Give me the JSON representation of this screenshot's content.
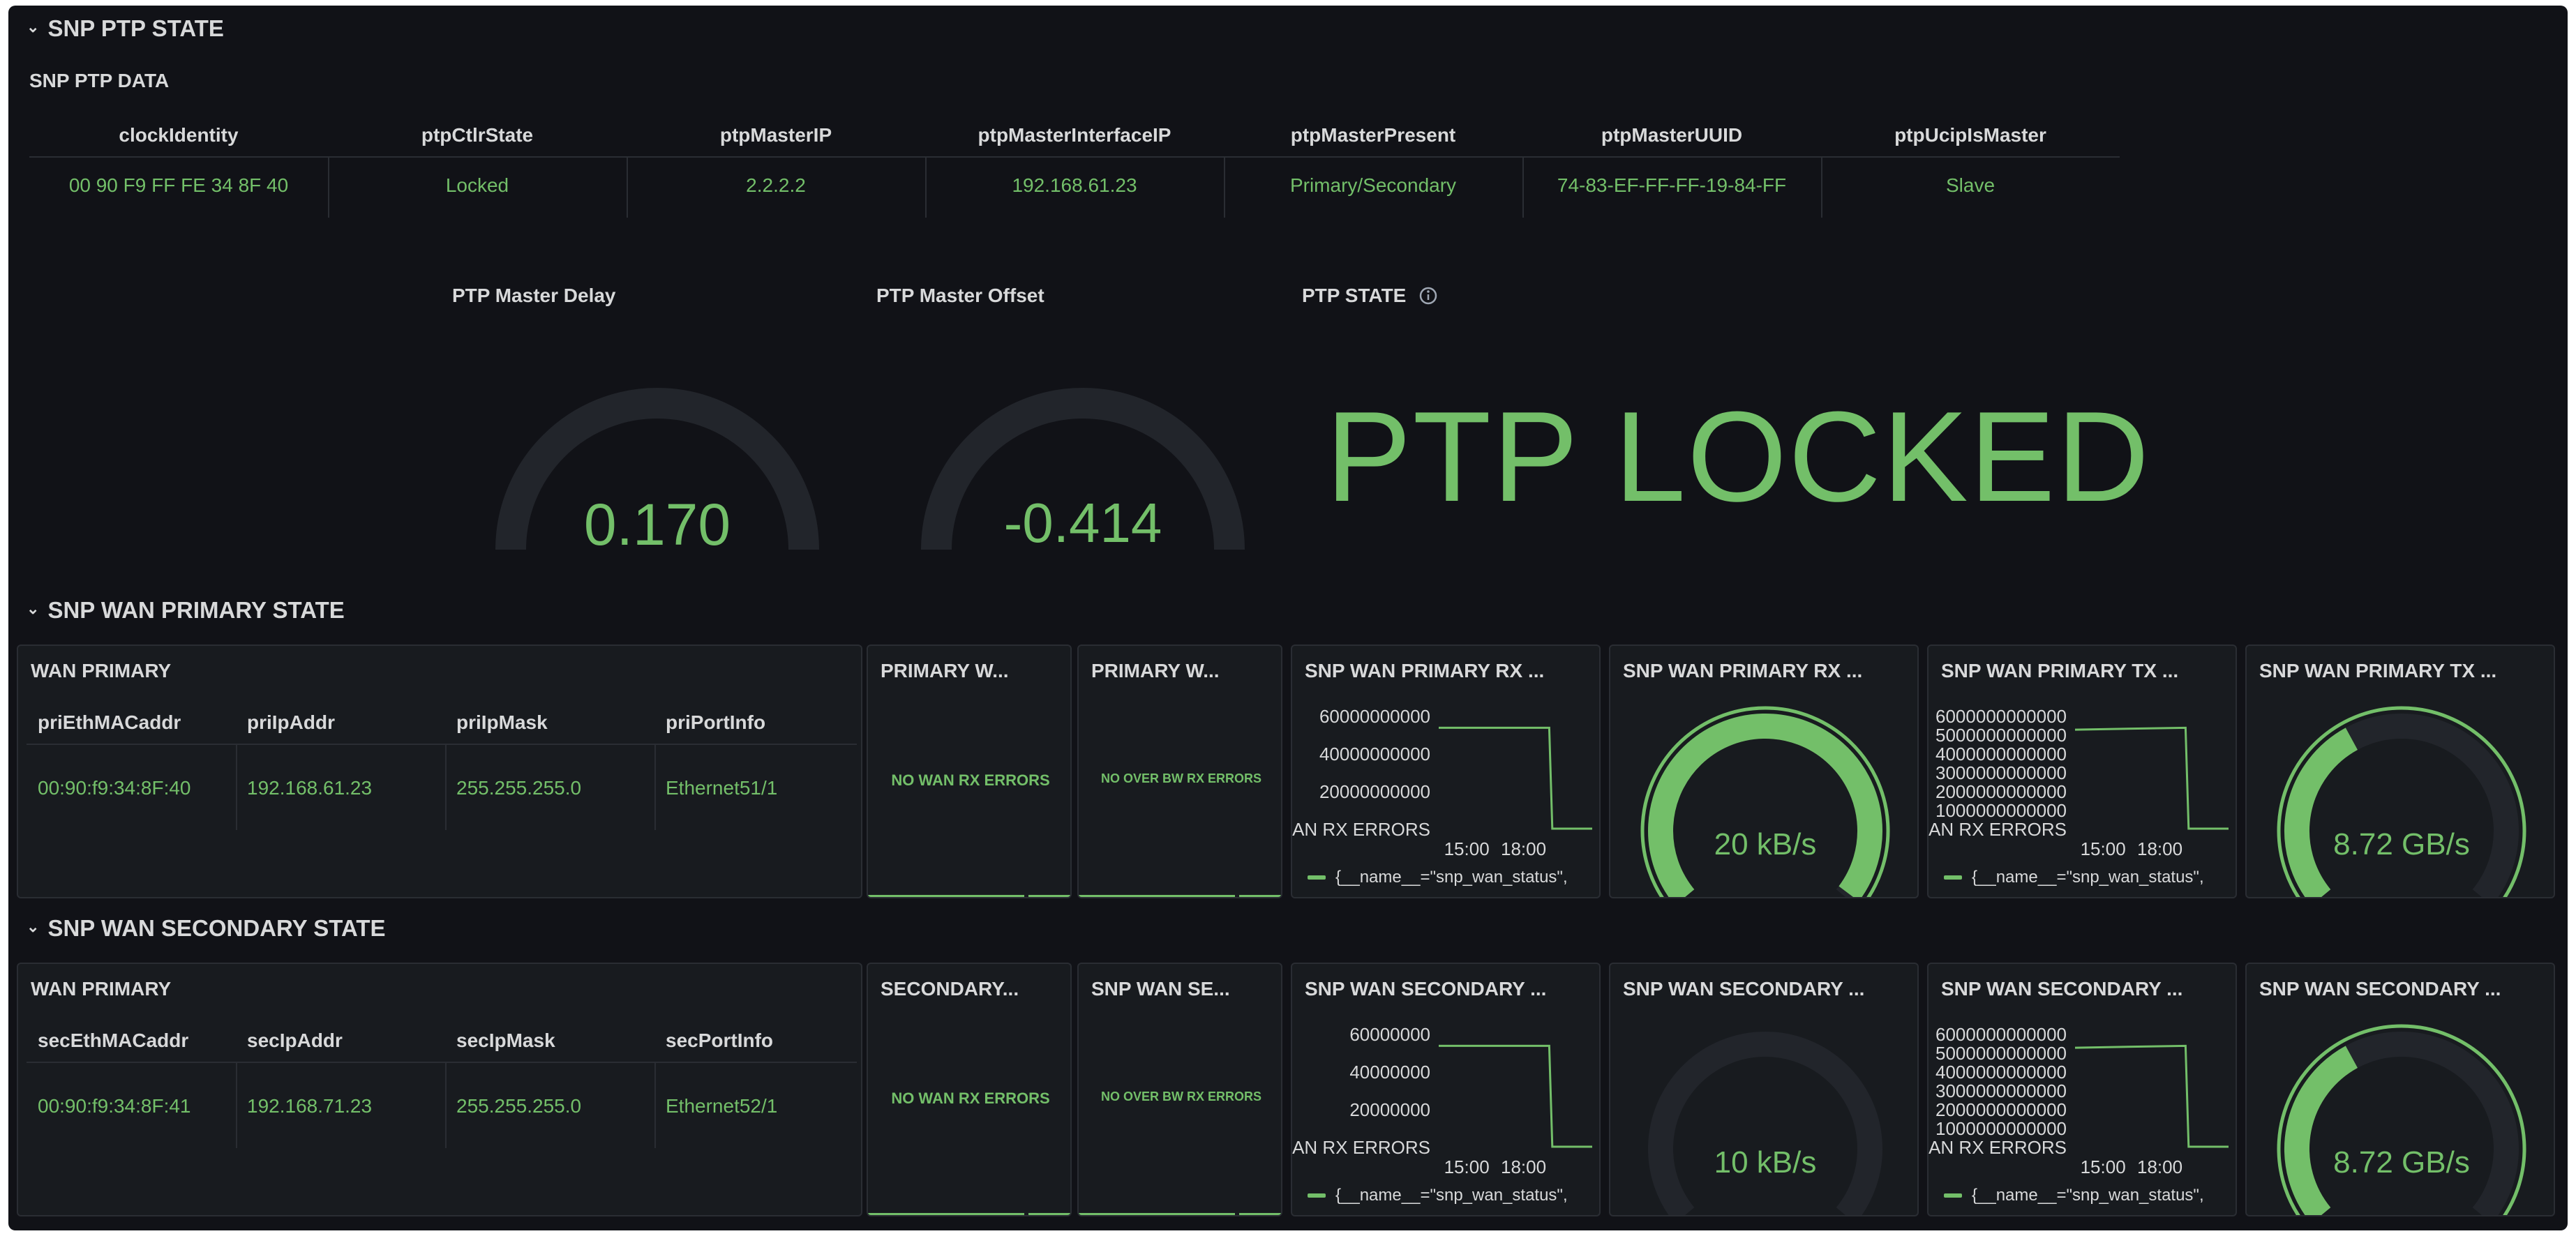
{
  "colors": {
    "accent": "#73bf69",
    "background": "#111217",
    "panel": "#181b1f",
    "gauge_track": "#22252b"
  },
  "ptp_row": {
    "header": "SNP PTP STATE",
    "table_title": "SNP PTP DATA",
    "columns": [
      "clockIdentity",
      "ptpCtlrState",
      "ptpMasterIP",
      "ptpMasterInterfaceIP",
      "ptpMasterPresent",
      "ptpMasterUUID",
      "ptpUcipIsMaster"
    ],
    "values": [
      "00 90 F9 FF FE 34 8F 40",
      "Locked",
      "2.2.2.2",
      "192.168.61.23",
      "Primary/Secondary",
      "74-83-EF-FF-FF-19-84-FF",
      "Slave"
    ],
    "delay_title": "PTP Master Delay",
    "delay_value": "0.170",
    "offset_title": "PTP Master Offset",
    "offset_value": "-0.414",
    "state_title": "PTP STATE",
    "info_icon": "info-circle-icon",
    "state_value": "PTP LOCKED"
  },
  "primary_row": {
    "header": "SNP WAN PRIMARY STATE",
    "table_title": "WAN PRIMARY",
    "columns": [
      "priEthMACaddr",
      "priIpAddr",
      "priIpMask",
      "priPortInfo"
    ],
    "values": [
      "00:90:f9:34:8F:40",
      "192.168.61.23",
      "255.255.255.0",
      "Ethernet51/1"
    ],
    "stat1_title": "PRIMARY W...",
    "stat1_text": "NO WAN RX ERRORS",
    "stat2_title": "PRIMARY W...",
    "stat2_text": "NO OVER BW RX ERRORS",
    "rx_chart_title": "SNP WAN PRIMARY RX ...",
    "rx_gauge_title": "SNP WAN PRIMARY RX ...",
    "rx_gauge_value": "20 kB/s",
    "rx_gauge_fraction": 0.99,
    "tx_chart_title": "SNP WAN PRIMARY TX ...",
    "tx_gauge_title": "SNP WAN PRIMARY TX ...",
    "tx_gauge_value": "8.72 GB/s",
    "tx_gauge_fraction": 0.39,
    "legend": "{__name__=\"snp_wan_status\","
  },
  "secondary_row": {
    "header": "SNP WAN SECONDARY STATE",
    "table_title": "WAN PRIMARY",
    "columns": [
      "secEthMACaddr",
      "secIpAddr",
      "secIpMask",
      "secPortInfo"
    ],
    "values": [
      "00:90:f9:34:8F:41",
      "192.168.71.23",
      "255.255.255.0",
      "Ethernet52/1"
    ],
    "stat1_title": "SECONDARY...",
    "stat1_text": "NO WAN RX ERRORS",
    "stat2_title": "SNP WAN SE...",
    "stat2_text": "NO OVER BW RX ERRORS",
    "rx_chart_title": "SNP WAN SECONDARY ...",
    "rx_gauge_title": "SNP WAN SECONDARY ...",
    "rx_gauge_value": "10 kB/s",
    "rx_gauge_fraction": 0.0,
    "tx_chart_title": "SNP WAN SECONDARY ...",
    "tx_gauge_title": "SNP WAN SECONDARY ...",
    "tx_gauge_value": "8.72 GB/s",
    "tx_gauge_fraction": 0.39,
    "legend": "{__name__=\"snp_wan_status\","
  },
  "chart_data": [
    {
      "type": "line",
      "panel": "primary-rx",
      "x_ticks": [
        "15:00",
        "18:00"
      ],
      "y_ticks": [
        "60000000000",
        "40000000000",
        "20000000000",
        "AN RX ERRORS"
      ],
      "series": [
        {
          "name": "{__name__=\"snp_wan_status\",",
          "x": [
            "13:30",
            "17:45",
            "17:50",
            "19:30"
          ],
          "values": [
            68000000000,
            68000000000,
            0,
            0
          ]
        }
      ]
    },
    {
      "type": "line",
      "panel": "primary-tx",
      "x_ticks": [
        "15:00",
        "18:00"
      ],
      "y_ticks": [
        "6000000000000",
        "5000000000000",
        "4000000000000",
        "3000000000000",
        "2000000000000",
        "1000000000000",
        "AN RX ERRORS"
      ],
      "series": [
        {
          "name": "{__name__=\"snp_wan_status\",",
          "x": [
            "13:30",
            "17:45",
            "17:50",
            "19:30"
          ],
          "values": [
            5200000000000,
            5300000000000,
            0,
            0
          ]
        }
      ]
    },
    {
      "type": "line",
      "panel": "secondary-rx",
      "x_ticks": [
        "15:00",
        "18:00"
      ],
      "y_ticks": [
        "60000000",
        "40000000",
        "20000000",
        "AN RX ERRORS"
      ],
      "series": [
        {
          "name": "{__name__=\"snp_wan_status\",",
          "x": [
            "13:30",
            "17:45",
            "17:50",
            "19:30"
          ],
          "values": [
            55000000,
            55000000,
            0,
            0
          ]
        }
      ]
    },
    {
      "type": "line",
      "panel": "secondary-tx",
      "x_ticks": [
        "15:00",
        "18:00"
      ],
      "y_ticks": [
        "6000000000000",
        "5000000000000",
        "4000000000000",
        "3000000000000",
        "2000000000000",
        "1000000000000",
        "AN RX ERRORS"
      ],
      "series": [
        {
          "name": "{__name__=\"snp_wan_status\",",
          "x": [
            "13:30",
            "17:45",
            "17:50",
            "19:30"
          ],
          "values": [
            5200000000000,
            5300000000000,
            0,
            0
          ]
        }
      ]
    }
  ]
}
